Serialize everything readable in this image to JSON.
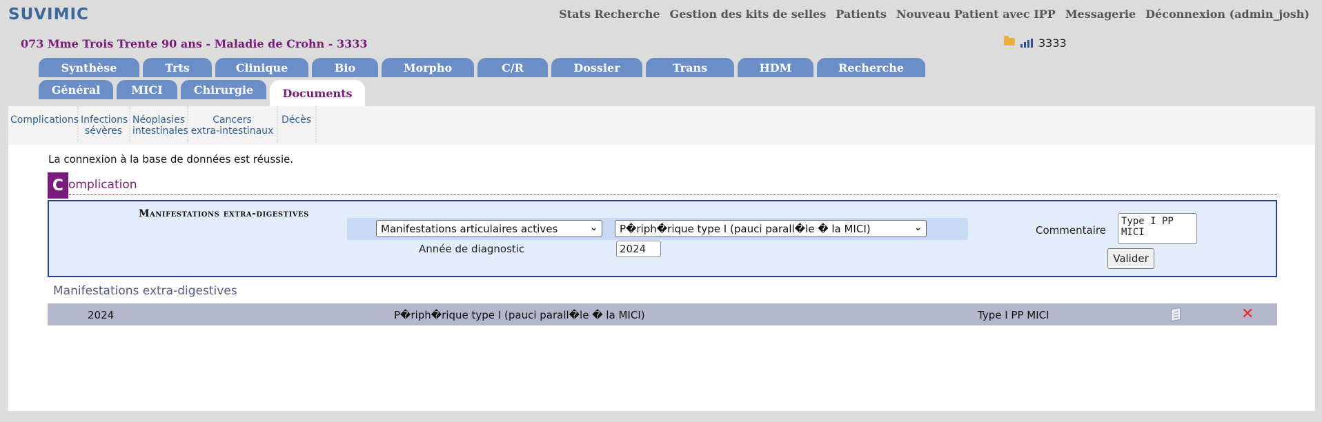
{
  "app": {
    "brand": "SUVIMIC"
  },
  "topnav": [
    "Stats Recherche",
    "Gestion des kits de selles",
    "Patients",
    "Nouveau Patient avec IPP",
    "Messagerie",
    "Déconnexion (admin_josh)"
  ],
  "patient": {
    "header": "073 Mme Trois Trente 90 ans - Maladie de Crohn -  3333",
    "id_right": "3333"
  },
  "tabs_main": [
    "Synthèse",
    "Trts",
    "Clinique",
    "Bio",
    "Morpho",
    "C/R",
    "Dossier",
    "Trans",
    "HDM",
    "Recherche"
  ],
  "tabs_sub": [
    "Général",
    "MICI",
    "Chirurgie",
    "Documents"
  ],
  "tabs_sub_active": "Documents",
  "subnav": [
    [
      "Complications"
    ],
    [
      "Infections",
      "sévères"
    ],
    [
      "Néoplasies",
      "intestinales"
    ],
    [
      "Cancers",
      "extra-intestinaux"
    ],
    [
      "Décès"
    ]
  ],
  "status_message": "La connexion à la base de données est réussie.",
  "section": {
    "letter": "C",
    "rest": "omplication"
  },
  "form": {
    "label": "Manifestations extra-digestives",
    "select1": "Manifestations articulaires actives",
    "select2": "P�riph�rique type I (pauci parall�le � la MICI)",
    "annee_label": "Année de diagnostic",
    "annee_value": "2024",
    "commentaire_label": "Commentaire",
    "commentaire_value": "Type I PP\nMICI",
    "submit": "Valider"
  },
  "list": {
    "title": "Manifestations extra-digestives",
    "rows": [
      {
        "year": "2024",
        "type": "P�riph�rique type I (pauci parall�le � la MICI)",
        "comment": "Type I PP MICI"
      }
    ]
  },
  "icons": {
    "edit": "edit-document-icon",
    "delete": "delete-x-icon",
    "folder": "folder-icon",
    "signal": "signal-bars-icon"
  },
  "colors": {
    "brand": "#3d6699",
    "accent": "#7a1a7a",
    "tab": "#6b8ec6",
    "row": "#b4b7cc",
    "delete": "#e8262c"
  }
}
